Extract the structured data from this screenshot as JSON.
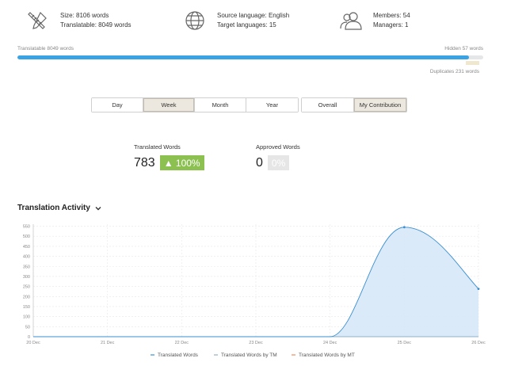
{
  "stats": {
    "size": "Size: 8106 words",
    "translatable": "Translatable: 8049 words",
    "source_language": "Source language: English",
    "target_languages": "Target languages: 15",
    "members": "Members: 54",
    "managers": "Managers: 1"
  },
  "progress": {
    "left_label": "Translatable 8049 words",
    "right_label": "Hidden 57 words",
    "duplicates_label": "Duplicates 231 words",
    "fill_fraction": 0.97
  },
  "period_tabs": [
    {
      "label": "Day",
      "active": false
    },
    {
      "label": "Week",
      "active": true
    },
    {
      "label": "Month",
      "active": false
    },
    {
      "label": "Year",
      "active": false
    }
  ],
  "scope_tabs": [
    {
      "label": "Overall",
      "active": false
    },
    {
      "label": "My Contribution",
      "active": true
    }
  ],
  "metrics": {
    "translated_label": "Translated Words",
    "translated_value": "783",
    "translated_badge": "▲ 100%",
    "approved_label": "Approved Words",
    "approved_value": "0",
    "approved_badge": "0%"
  },
  "activity": {
    "title": "Translation Activity"
  },
  "colors": {
    "accent": "#3aa3e3",
    "green": "#8cc152",
    "series_tm": "#8fb0c8",
    "series_mt": "#f08a5d"
  },
  "chart_data": {
    "type": "area",
    "x": [
      "20 Dec",
      "21 Dec",
      "22 Dec",
      "23 Dec",
      "24 Dec",
      "25 Dec",
      "26 Dec"
    ],
    "yticks": [
      0,
      50,
      100,
      150,
      200,
      250,
      300,
      350,
      400,
      450,
      500,
      550
    ],
    "ylim": [
      0,
      560
    ],
    "grid": true,
    "legend_position": "bottom",
    "series": [
      {
        "name": "Translated Words",
        "values": [
          0,
          0,
          0,
          0,
          0,
          545,
          238
        ]
      },
      {
        "name": "Translated Words by TM",
        "values": [
          0,
          0,
          0,
          0,
          0,
          0,
          0
        ]
      },
      {
        "name": "Translated Words by MT",
        "values": [
          0,
          0,
          0,
          0,
          0,
          0,
          0
        ]
      }
    ]
  }
}
